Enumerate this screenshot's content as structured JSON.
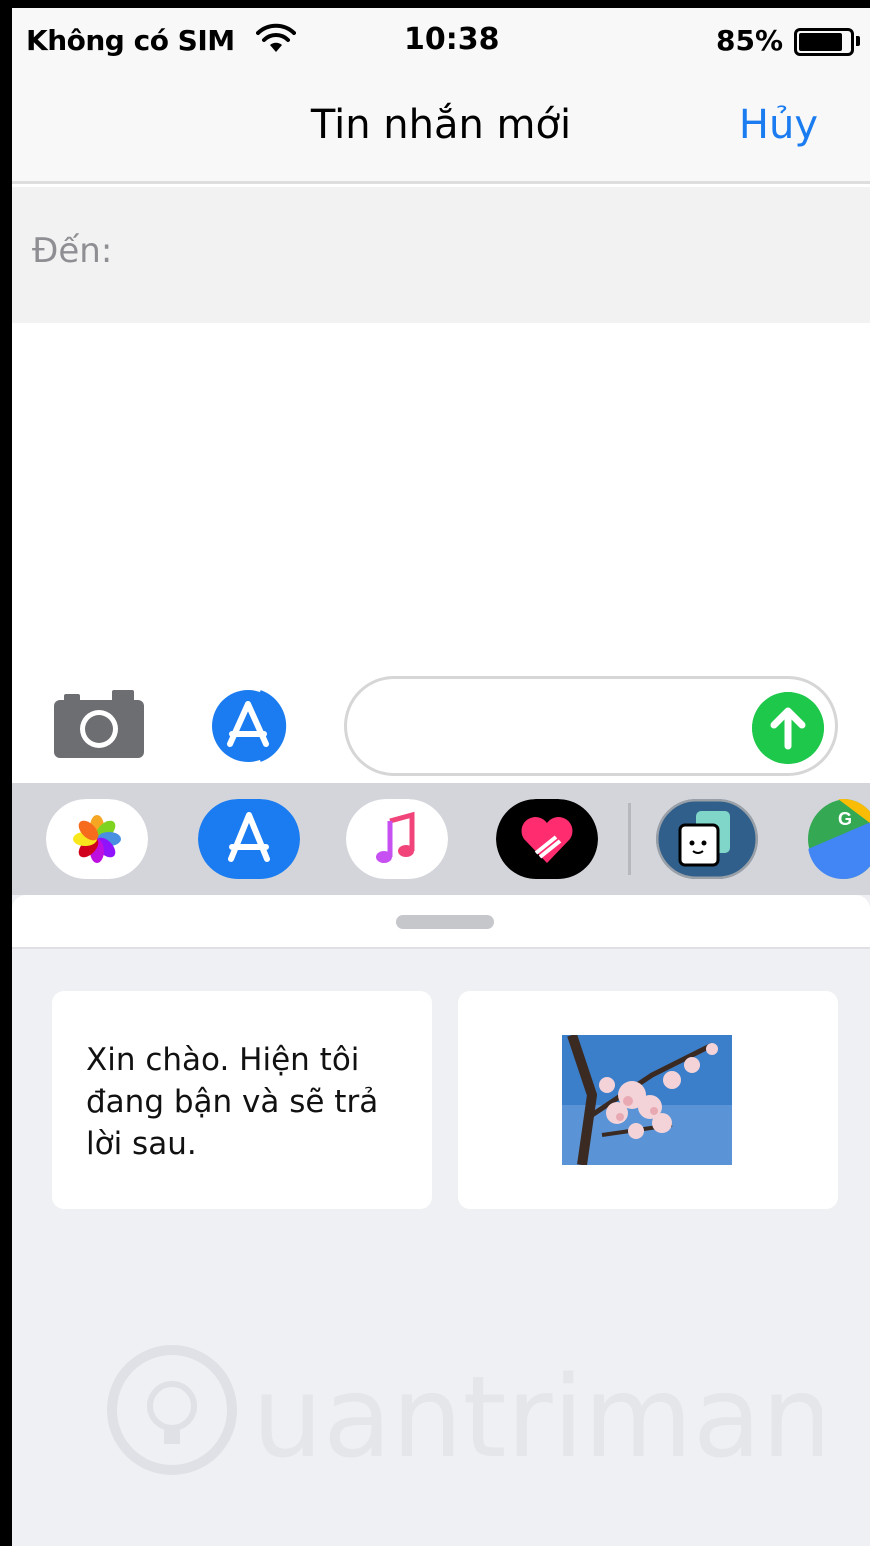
{
  "status_bar": {
    "carrier": "Không có SIM",
    "time": "10:38",
    "battery_percent": "85%",
    "battery_level": 0.85
  },
  "nav": {
    "title": "Tin nhắn mới",
    "cancel_label": "Hủy"
  },
  "to_field": {
    "label": "Đến:"
  },
  "compose": {
    "message_value": ""
  },
  "app_drawer": {
    "apps": [
      "photos-icon",
      "app-store-icon",
      "music-icon",
      "digital-touch-icon",
      "stickers-icon",
      "google-maps-icon"
    ]
  },
  "suggestions": {
    "text_reply": "Xin chào. Hiện tôi đang bận và sẽ trả lời sau.",
    "photo_reply": "photo-thumbnail"
  },
  "watermark": "Quantrimang",
  "colors": {
    "accent": "#1a7cf0",
    "send": "#1ec84a",
    "drawer_bg": "#d3d5da",
    "panel_bg": "#eff0f3"
  }
}
